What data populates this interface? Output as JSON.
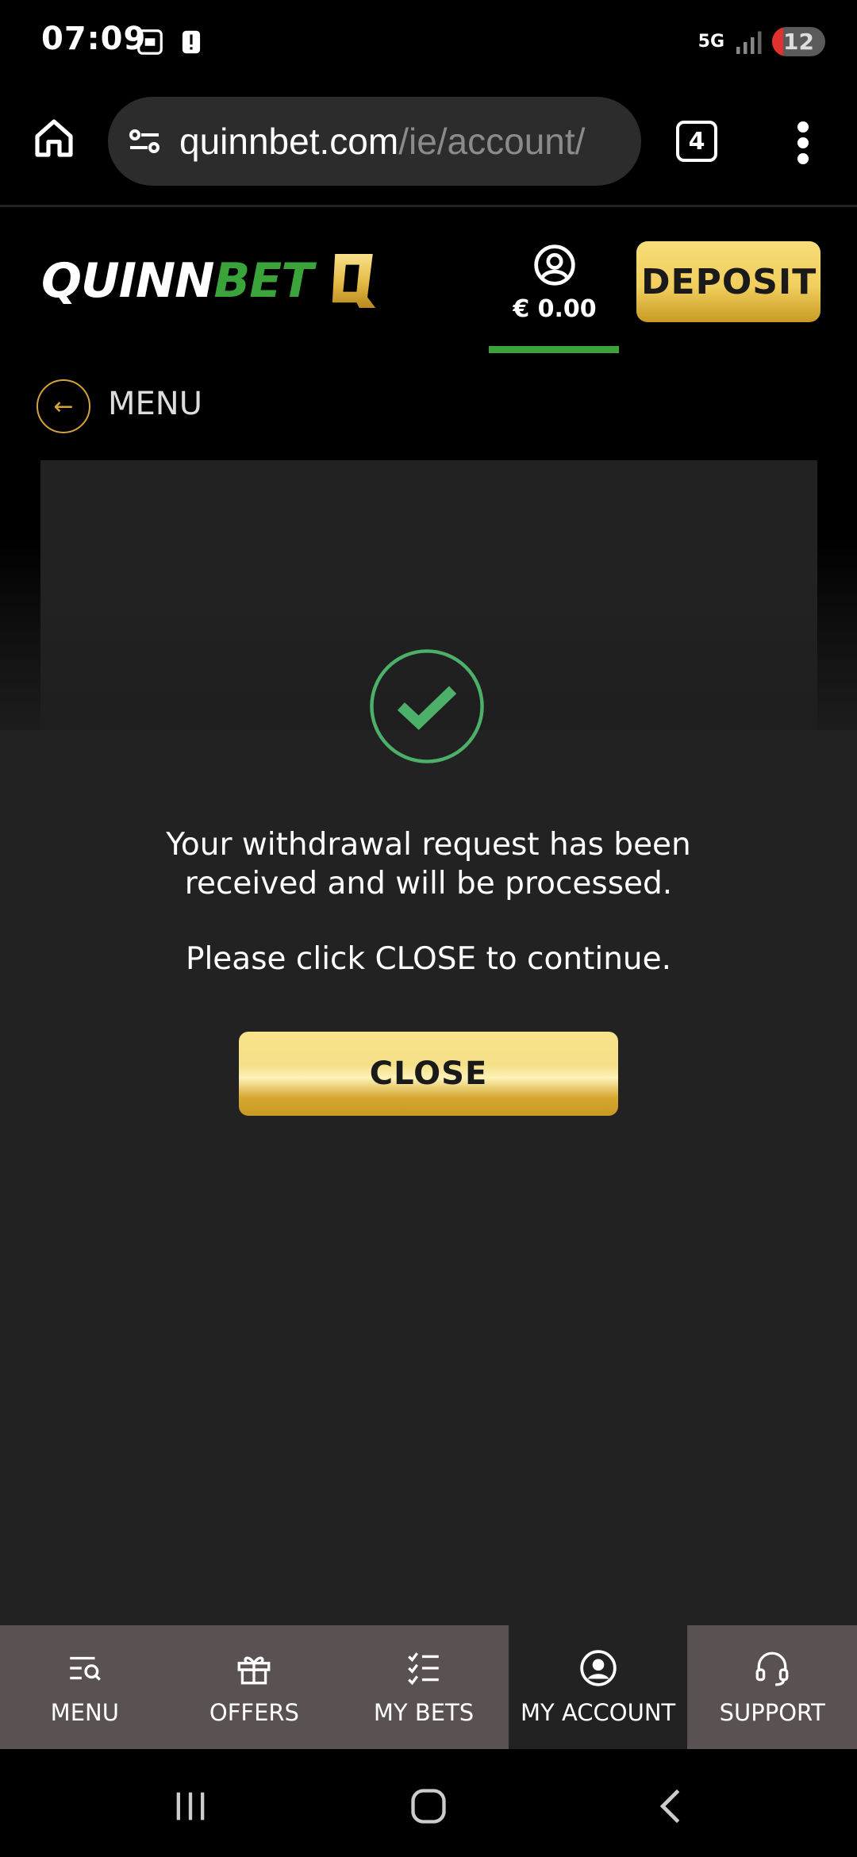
{
  "status_bar": {
    "time": "07:09",
    "network": "5G",
    "battery": "12"
  },
  "browser": {
    "url_domain": "quinnbet.com",
    "url_path": "/ie/account/",
    "tab_count": "4"
  },
  "header": {
    "logo_part1": "QUINN",
    "logo_part2": "BET",
    "balance": "€ 0.00",
    "deposit_label": "DEPOSIT"
  },
  "back": {
    "label": "MENU"
  },
  "dialog": {
    "message": "Your withdrawal request has been received and will be processed.",
    "instruction": "Please click CLOSE to continue.",
    "close_label": "CLOSE"
  },
  "bottom_nav": {
    "items": [
      {
        "label": "MENU",
        "icon": "menu-search-icon"
      },
      {
        "label": "OFFERS",
        "icon": "gift-icon"
      },
      {
        "label": "MY BETS",
        "icon": "checklist-icon"
      },
      {
        "label": "MY ACCOUNT",
        "icon": "user-circle-icon"
      },
      {
        "label": "SUPPORT",
        "icon": "headset-icon"
      }
    ]
  },
  "colors": {
    "accent_green": "#3aa33a",
    "gold": "#f2cf5d",
    "check_green": "#4caf6a"
  }
}
